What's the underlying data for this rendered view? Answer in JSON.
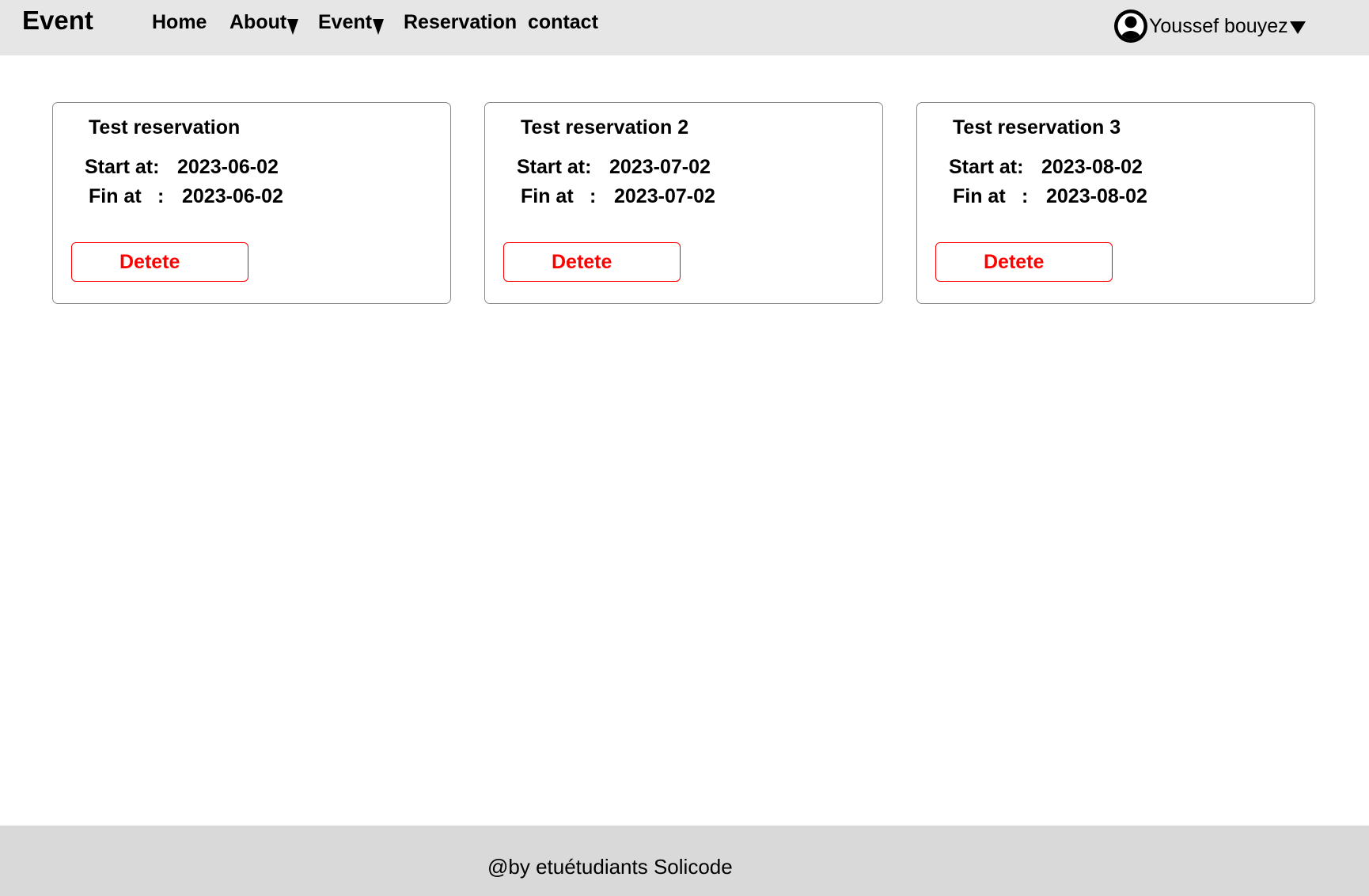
{
  "navbar": {
    "brand": "Event",
    "items": [
      {
        "label": "Home",
        "has_dropdown": false
      },
      {
        "label": "About",
        "has_dropdown": true
      },
      {
        "label": "Event",
        "has_dropdown": true
      },
      {
        "label": "Reservation",
        "has_dropdown": false
      },
      {
        "label": "contact",
        "has_dropdown": false
      }
    ],
    "user": {
      "name": "Youssef bouyez",
      "avatar_icon": "user-circle-icon",
      "dropdown_icon": "caret-down-icon"
    }
  },
  "reservations": [
    {
      "title": "Test reservation",
      "start_label": "Start at:",
      "start_value": "2023-06-02",
      "fin_label": "Fin at",
      "fin_colon": ":",
      "fin_value": "2023-06-02",
      "delete_label": "Detete"
    },
    {
      "title": "Test reservation 2",
      "start_label": "Start at:",
      "start_value": "2023-07-02",
      "fin_label": "Fin at",
      "fin_colon": ":",
      "fin_value": "2023-07-02",
      "delete_label": "Detete"
    },
    {
      "title": "Test reservation 3",
      "start_label": "Start at:",
      "start_value": "2023-08-02",
      "fin_label": "Fin at",
      "fin_colon": ":",
      "fin_value": "2023-08-02",
      "delete_label": "Detete"
    }
  ],
  "footer": {
    "text": "@by etuétudiants Solicode"
  },
  "colors": {
    "navbar_bg": "#e6e6e6",
    "footer_bg": "#d9d9d9",
    "danger": "#ff0000",
    "card_border": "#8a8a8a"
  }
}
